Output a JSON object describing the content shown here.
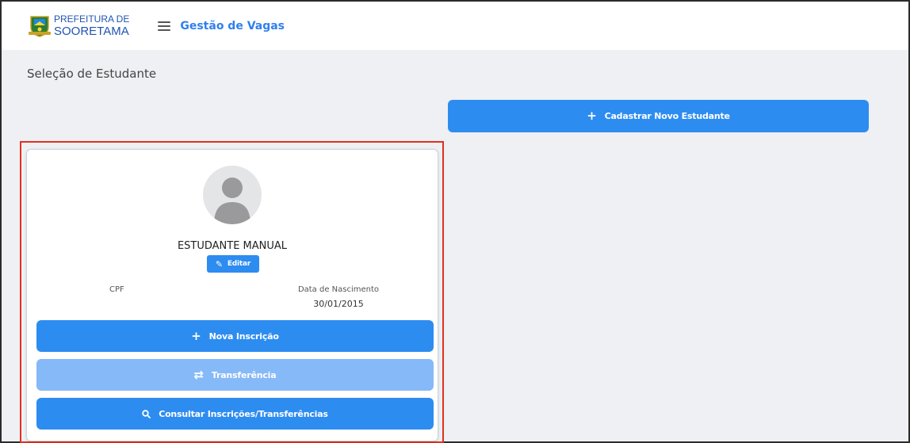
{
  "header": {
    "logo_line1": "PREFEITURA DE",
    "logo_line2": "SOORETAMA",
    "app_title": "Gestão de Vagas"
  },
  "page": {
    "title": "Seleção de Estudante"
  },
  "actions": {
    "new_student_label": "Cadastrar Novo Estudante"
  },
  "student_card": {
    "name": "ESTUDANTE MANUAL",
    "edit_label": "Editar",
    "cpf_label": "CPF",
    "cpf_value": "",
    "dob_label": "Data de Nascimento",
    "dob_value": "30/01/2015",
    "buttons": [
      {
        "label": "Nova Inscrição",
        "icon": "plus-icon",
        "enabled": true
      },
      {
        "label": "Transferência",
        "icon": "swap-arrows-icon",
        "enabled": false
      },
      {
        "label": "Consultar Inscrições/Transferências",
        "icon": "search-icon",
        "enabled": true
      }
    ]
  },
  "colors": {
    "primary": "#2d8cf0",
    "primary_disabled": "#86b9f7",
    "highlight_border": "#e0301e",
    "title_blue": "#2f80ed",
    "background": "#eef0f3"
  }
}
